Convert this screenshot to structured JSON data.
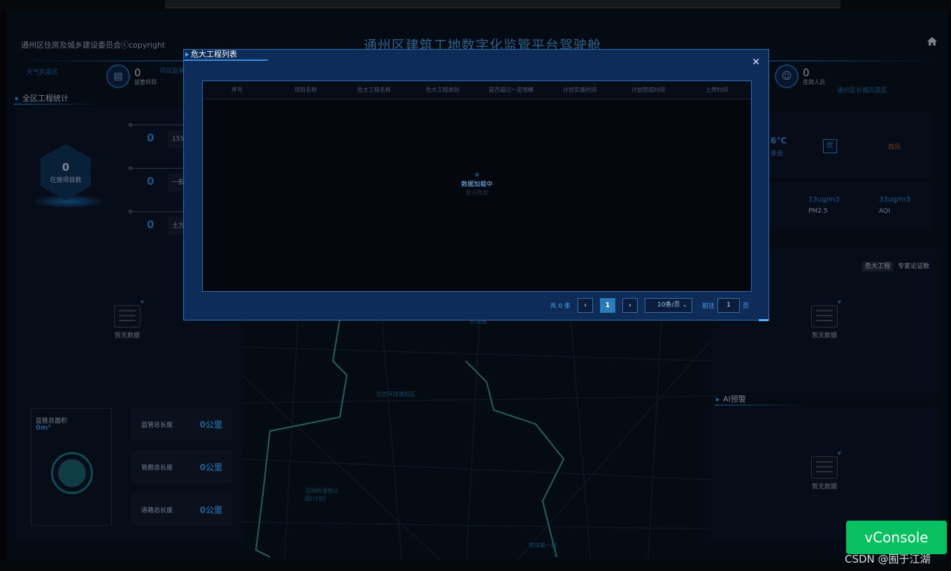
{
  "header": {
    "title": "通州区建筑工地数字化监管平台驾驶舱",
    "org": "通州区住房及城乡建设委员会ⓒcopyright"
  },
  "chips": {
    "left": {
      "value": "0",
      "label": "监管项目"
    },
    "right": {
      "value": "0",
      "label": "在岗人员"
    }
  },
  "dim_tags": {
    "left_a": "天气风景区",
    "left_b": "项目监管",
    "right": "通州区长城风景区"
  },
  "left": {
    "section_title": "全区工程统计",
    "hex": {
      "value": "0",
      "label": "在施项目数"
    },
    "rows": [
      {
        "value": "0",
        "box": "155"
      },
      {
        "value": "0",
        "box": "一般"
      },
      {
        "value": "0",
        "box": "土方"
      }
    ],
    "nodata": "暂无数据",
    "area": {
      "title": "监管总面积",
      "value": "0m²"
    },
    "lengths": [
      {
        "label": "监管总长度",
        "value": "0公里"
      },
      {
        "label": "管廊总长度",
        "value": "0公里"
      },
      {
        "label": "道路总长度",
        "value": "0公里"
      }
    ]
  },
  "right": {
    "weather_temp": "6°C",
    "weather_cond": "多云",
    "air_quality": "优",
    "wind": "西风",
    "pm25_value": "13ug/m3",
    "pm25_label": "PM2.5",
    "aqi_value": "33ug/m3",
    "aqi_label": "AQI",
    "tabs": [
      "危大工程",
      "专家论证数"
    ],
    "nodata": "暂无数据",
    "ai_title": "AI预警",
    "ai_nodata": "暂无数据"
  },
  "map_labels": {
    "top": "台湖镇",
    "mid": "北京环球度假区",
    "left": "马驹桥湿地公园(计划)",
    "bottom": "燕郊第一城"
  },
  "modal": {
    "title": "危大工程列表",
    "columns": [
      "序号",
      "项目名称",
      "危大工程名称",
      "危大工程类别",
      "是否超过一定规模",
      "计划实施时间",
      "计划完成时间",
      "上传时间"
    ],
    "loading_icon": "loading-icon",
    "loading_text": "数据加载中",
    "empty_text": "暂无数据",
    "pager": {
      "total": "共 0 条",
      "current_page": "1",
      "page_size": "10条/页",
      "goto_label": "前往",
      "goto_value": "1",
      "page_unit": "页"
    }
  },
  "vconsole": "vConsole",
  "watermark": "CSDN @囿于江湖",
  "colors": {
    "accent": "#4fb1ff",
    "modal_bg": "#0d2c57",
    "vconsole": "#07c160"
  }
}
